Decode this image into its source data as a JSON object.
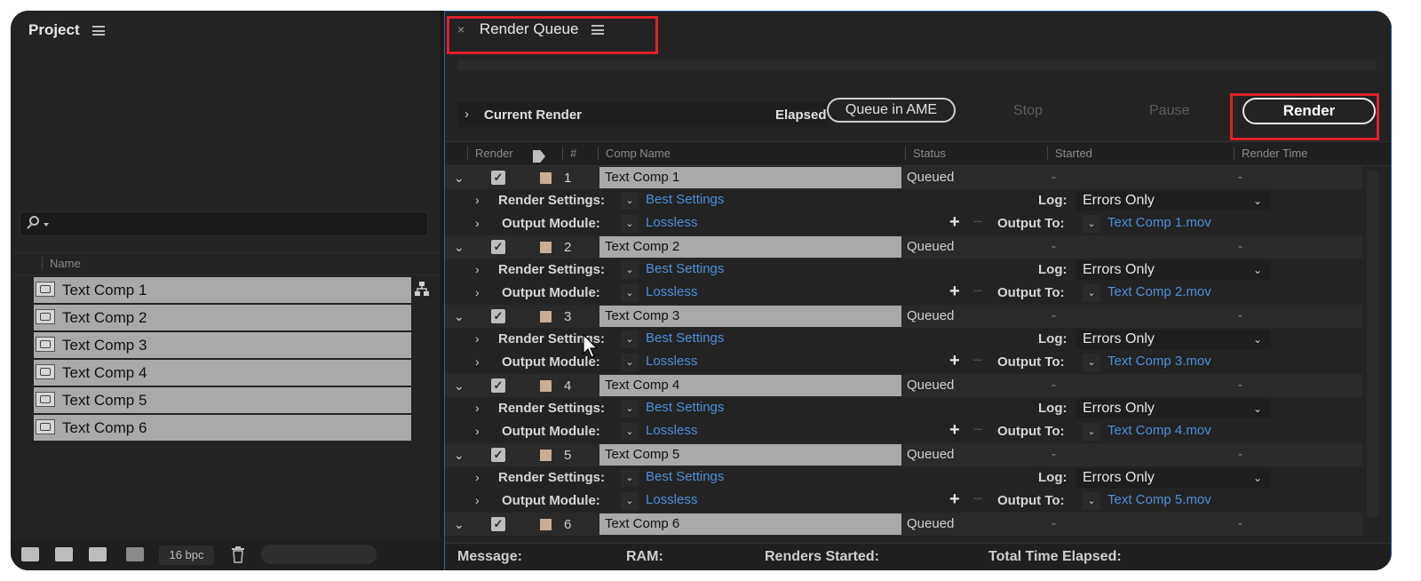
{
  "project": {
    "tab_title": "Project",
    "name_column": "Name",
    "items": [
      {
        "label": "Text Comp 1"
      },
      {
        "label": "Text Comp 2"
      },
      {
        "label": "Text Comp 3"
      },
      {
        "label": "Text Comp 4"
      },
      {
        "label": "Text Comp 5"
      },
      {
        "label": "Text Comp 6"
      }
    ],
    "footer": {
      "bpc": "16 bpc"
    }
  },
  "render_queue": {
    "tab_title": "Render Queue",
    "current_render": "Current Render",
    "elapsed_label": "Elapsed",
    "buttons": {
      "queue_ame": "Queue in AME",
      "stop": "Stop",
      "pause": "Pause",
      "render": "Render"
    },
    "columns": {
      "render": "Render",
      "num": "#",
      "comp_name": "Comp Name",
      "status": "Status",
      "started": "Started",
      "render_time": "Render Time"
    },
    "labels": {
      "render_settings": "Render Settings:",
      "output_module": "Output Module:",
      "log": "Log:",
      "output_to": "Output To:"
    },
    "items": [
      {
        "num": "1",
        "name": "Text Comp 1",
        "status": "Queued",
        "started": "-",
        "render_time": "-",
        "render_settings": "Best Settings",
        "output_module": "Lossless",
        "log": "Errors Only",
        "output_file": "Text Comp 1.mov"
      },
      {
        "num": "2",
        "name": "Text Comp 2",
        "status": "Queued",
        "started": "-",
        "render_time": "-",
        "render_settings": "Best Settings",
        "output_module": "Lossless",
        "log": "Errors Only",
        "output_file": "Text Comp 2.mov"
      },
      {
        "num": "3",
        "name": "Text Comp 3",
        "status": "Queued",
        "started": "-",
        "render_time": "-",
        "render_settings": "Best Settings",
        "output_module": "Lossless",
        "log": "Errors Only",
        "output_file": "Text Comp 3.mov"
      },
      {
        "num": "4",
        "name": "Text Comp 4",
        "status": "Queued",
        "started": "-",
        "render_time": "-",
        "render_settings": "Best Settings",
        "output_module": "Lossless",
        "log": "Errors Only",
        "output_file": "Text Comp 4.mov"
      },
      {
        "num": "5",
        "name": "Text Comp 5",
        "status": "Queued",
        "started": "-",
        "render_time": "-",
        "render_settings": "Best Settings",
        "output_module": "Lossless",
        "log": "Errors Only",
        "output_file": "Text Comp 5.mov"
      },
      {
        "num": "6",
        "name": "Text Comp 6",
        "status": "Queued",
        "started": "-",
        "render_time": "-"
      }
    ],
    "status_bar": {
      "message": "Message:",
      "ram": "RAM:",
      "renders_started": "Renders Started:",
      "total_time": "Total Time Elapsed:"
    }
  },
  "colors": {
    "highlight": "#e0202a",
    "link": "#4f8fd8",
    "swatch": "#c9ad95",
    "panel_border": "#2f5fa8"
  }
}
